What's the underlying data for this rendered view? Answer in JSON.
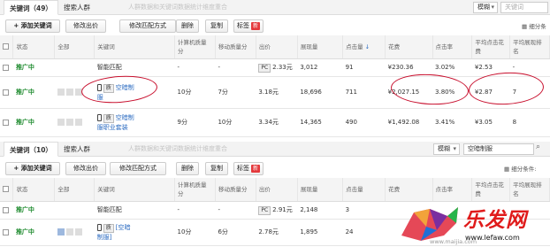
{
  "top": {
    "tabs": [
      "关键词（49）",
      "搜索人群"
    ],
    "ghost_text": "人群数据和关键词数据统计维度重合",
    "match_select": "模糊",
    "search_placeholder": "关键词",
    "toolbar": {
      "add": "+ 添加关键词",
      "bid": "修改出价",
      "match": "修改匹配方式",
      "delete": "删除",
      "copy": "复制",
      "tag": "标签",
      "new_badge": "新"
    },
    "filter": "细分条",
    "headers": [
      "",
      "状态",
      "全部",
      "关键词",
      "计算机质量分",
      "移动质量分",
      "出价",
      "展现量",
      "点击量",
      "花费",
      "点击率",
      "平均点击花费",
      "平均展现排名"
    ],
    "rows": [
      {
        "status": "推广中",
        "keyword": "智能匹配",
        "pc_q": "-",
        "mob_q": "-",
        "bid": "2.33元",
        "impressions": "3,012",
        "clicks": "91",
        "cost": "¥230.36",
        "ctr": "3.02%",
        "cpc": "¥2.53",
        "rank": "-"
      },
      {
        "status": "推广中",
        "keyword": "空暗制",
        "keyword2": "服",
        "pc_q": "10分",
        "mob_q": "7分",
        "bid": "3.18元",
        "impressions": "18,696",
        "clicks": "711",
        "cost": "¥2,027.15",
        "ctr": "3.80%",
        "cpc": "¥2.87",
        "rank": "7"
      },
      {
        "status": "推广中",
        "keyword": "空暗制",
        "keyword2": "服职业套装",
        "pc_q": "9分",
        "mob_q": "10分",
        "bid": "3.34元",
        "impressions": "14,365",
        "clicks": "490",
        "cost": "¥1,492.08",
        "ctr": "3.41%",
        "cpc": "¥3.05",
        "rank": "8"
      }
    ]
  },
  "bottom": {
    "tabs": [
      "关键词（10）",
      "搜索人群"
    ],
    "ghost_text": "人群数据和关键词数据统计维度重合",
    "match_select": "模糊",
    "search_value": "空暗制服",
    "toolbar": {
      "add": "+ 添加关键词",
      "bid": "修改出价",
      "match": "修改匹配方式",
      "delete": "删除",
      "copy": "复制",
      "tag": "标签",
      "new_badge": "新"
    },
    "filter": "细分条件:",
    "headers": [
      "",
      "状态",
      "全部",
      "关键词",
      "计算机质量分",
      "移动质量分",
      "出价",
      "展现量",
      "点击量",
      "花费",
      "点击率",
      "平均点击花费",
      "平均展现排名"
    ],
    "rows": [
      {
        "status": "推广中",
        "keyword": "智能匹配",
        "pc_q": "-",
        "mob_q": "-",
        "bid": "2.91元",
        "impressions": "2,148",
        "clicks": "3"
      },
      {
        "status": "推广中",
        "keyword": "[空暗",
        "keyword2": "制服]",
        "pc_q": "10分",
        "mob_q": "6分",
        "bid": "2.78元",
        "impressions": "1,895",
        "clicks": "24"
      }
    ]
  },
  "watermark": {
    "text": "乐发网",
    "url": "www.lefaw.com",
    "url2": "www.maijia.com"
  }
}
